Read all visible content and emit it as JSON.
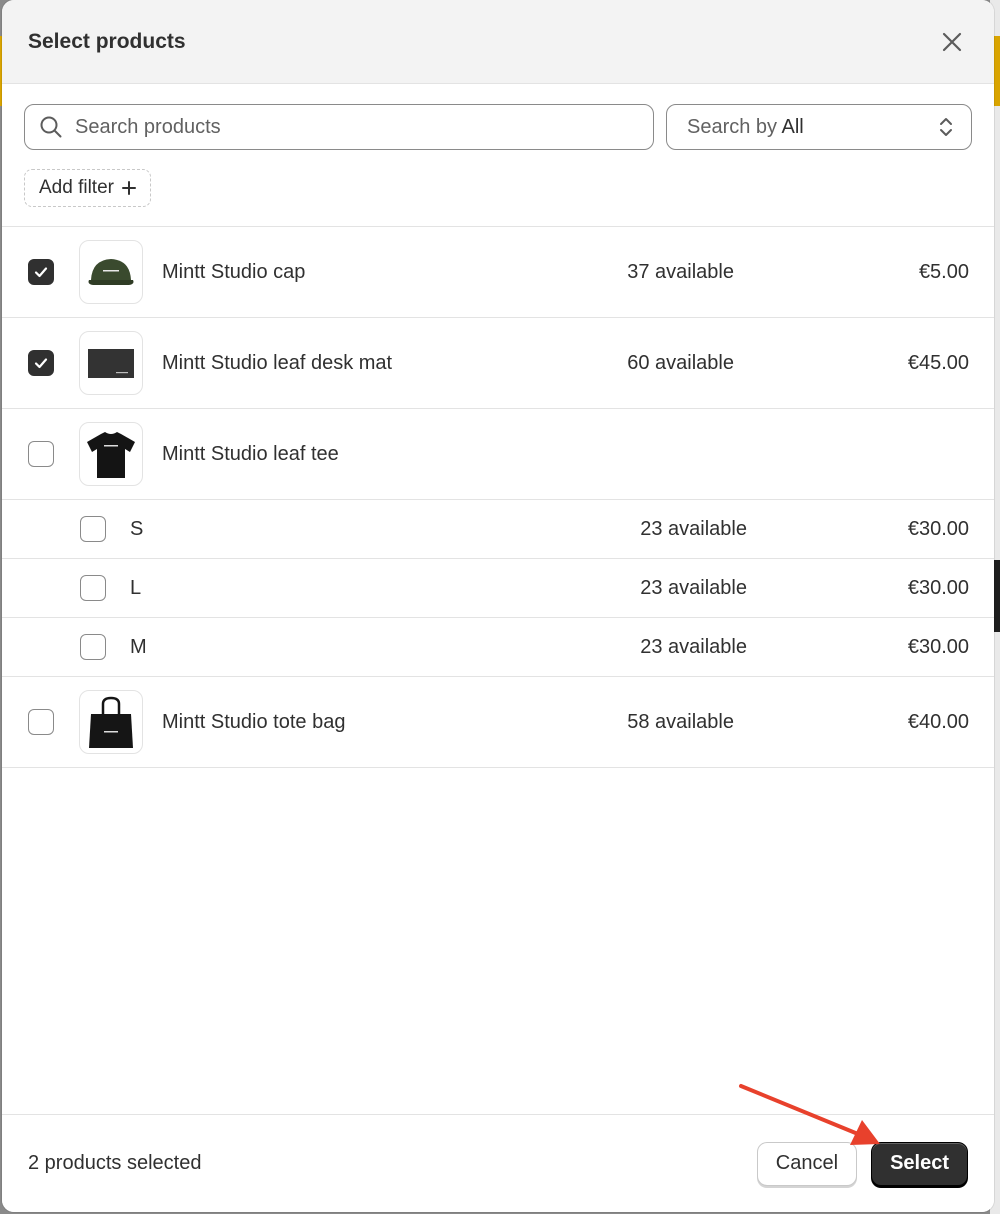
{
  "modal": {
    "title": "Select products",
    "close_icon": "close-icon"
  },
  "search": {
    "placeholder": "Search products",
    "value": "",
    "search_by_prefix": "Search by",
    "search_by_value": "All"
  },
  "filter": {
    "add_filter_label": "Add filter"
  },
  "products": [
    {
      "name": "Mintt Studio cap",
      "available": "37 available",
      "price": "€5.00",
      "checked": true,
      "image": "cap"
    },
    {
      "name": "Mintt Studio leaf desk mat",
      "available": "60 available",
      "price": "€45.00",
      "checked": true,
      "image": "desk-mat"
    },
    {
      "name": "Mintt Studio leaf tee",
      "available": "",
      "price": "",
      "checked": false,
      "image": "tee",
      "variants": [
        {
          "name": "S",
          "available": "23 available",
          "price": "€30.00",
          "checked": false
        },
        {
          "name": "L",
          "available": "23 available",
          "price": "€30.00",
          "checked": false
        },
        {
          "name": "M",
          "available": "23 available",
          "price": "€30.00",
          "checked": false
        }
      ]
    },
    {
      "name": "Mintt Studio tote bag",
      "available": "58 available",
      "price": "€40.00",
      "checked": false,
      "image": "tote-bag"
    }
  ],
  "footer": {
    "selected_count": "2 products selected",
    "cancel_label": "Cancel",
    "select_label": "Select"
  },
  "colors": {
    "primary_button": "#303030",
    "annotation_arrow": "#e8412c"
  }
}
